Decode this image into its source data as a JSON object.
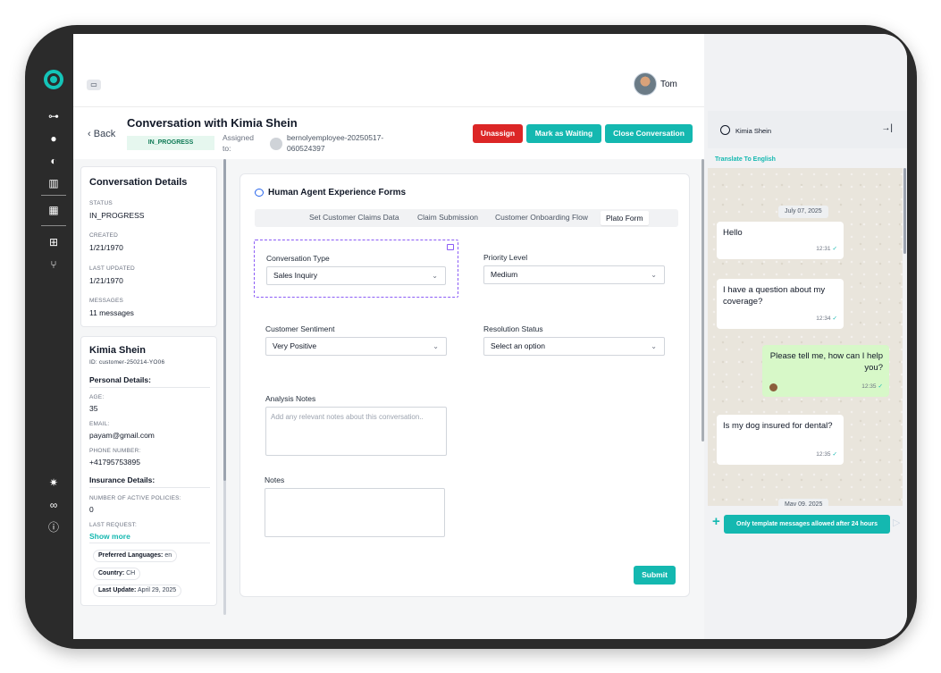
{
  "topbar": {
    "chat_icon": "message-square-icon",
    "user_name": "Tom"
  },
  "header": {
    "back_label": "Back",
    "title": "Conversation with Kimia Shein",
    "status": "IN_PROGRESS",
    "assigned_label": "Assigned to:",
    "assignee": "bernolyemployee-20250517-060524397",
    "buttons": {
      "unassign": "Unassign",
      "mark_waiting": "Mark as Waiting",
      "close": "Close Conversation"
    }
  },
  "details": {
    "title": "Conversation Details",
    "fields": [
      {
        "label": "STATUS",
        "value": "IN_PROGRESS"
      },
      {
        "label": "CREATED",
        "value": "1/21/1970"
      },
      {
        "label": "LAST UPDATED",
        "value": "1/21/1970"
      },
      {
        "label": "MESSAGES",
        "value": "11 messages"
      }
    ]
  },
  "profile": {
    "name": "Kimia Shein",
    "id": "ID: customer-250214-YO06",
    "personal_title": "Personal Details:",
    "age_label": "AGE:",
    "age": "35",
    "email_label": "EMAIL:",
    "email": "payam@gmail.com",
    "phone_label": "PHONE NUMBER:",
    "phone": "+41795753895",
    "insurance_title": "Insurance Details:",
    "policies_label": "NUMBER OF ACTIVE POLICIES:",
    "policies": "0",
    "last_request_label": "LAST REQUEST:",
    "show_more": "Show more",
    "tags": [
      {
        "key": "Preferred Languages:",
        "value": "en"
      },
      {
        "key": "Country:",
        "value": "CH"
      },
      {
        "key": "Last Update:",
        "value": "April 29, 2025"
      }
    ]
  },
  "forms": {
    "title": "Human Agent Experience Forms",
    "tabs": [
      "Set Customer Claims Data",
      "Claim Submission",
      "Customer Onboarding Flow",
      "Plato Form"
    ],
    "active_tab": "Plato Form",
    "conversation_type": {
      "label": "Conversation Type",
      "value": "Sales Inquiry"
    },
    "priority": {
      "label": "Priority Level",
      "value": "Medium"
    },
    "sentiment": {
      "label": "Customer Sentiment",
      "value": "Very Positive"
    },
    "resolution": {
      "label": "Resolution Status",
      "value": "Select an option"
    },
    "analysis": {
      "label": "Analysis Notes",
      "placeholder": "Add any relevant notes about this conversation.."
    },
    "notes": {
      "label": "Notes",
      "placeholder": ""
    },
    "submit": "Submit"
  },
  "whatsapp": {
    "contact": "Kimia Shein",
    "translate": "Translate To English",
    "date1": "July 07, 2025",
    "date2": "May 09, 2025",
    "messages": [
      {
        "dir": "in",
        "text": "Hello",
        "time": "12:31"
      },
      {
        "dir": "in",
        "text": "I have a question about my coverage?",
        "time": "12:34"
      },
      {
        "dir": "out",
        "text": "Please tell me, how can I help you?",
        "time": "12:35"
      },
      {
        "dir": "in",
        "text": "Is my dog insured for dental?",
        "time": "12:35"
      }
    ],
    "template_notice": "Only template messages allowed after 24 hours"
  },
  "colors": {
    "accent": "#14b8b0",
    "danger": "#dc2626",
    "frame": "#2b2b2b"
  }
}
